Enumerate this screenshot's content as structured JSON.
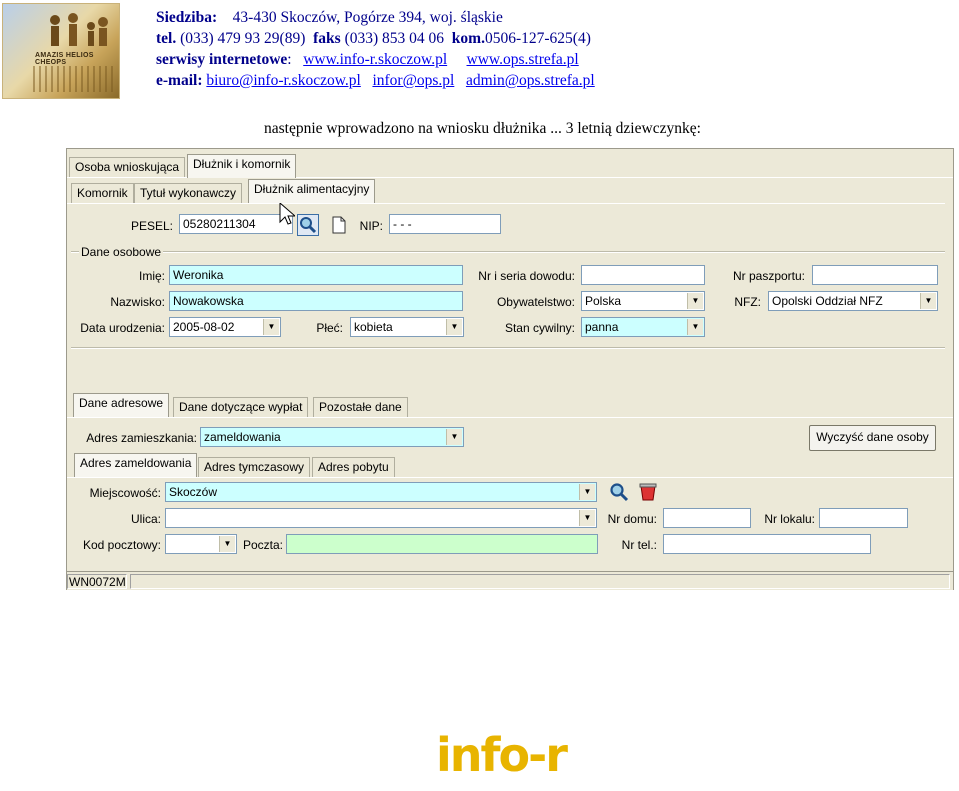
{
  "header": {
    "logo_text": "AMAZIS HELIOS CHEOPS",
    "siedziba_label": "Siedziba:",
    "siedziba_value": "43-430 Skoczów,  Pogórze 394,  woj. śląskie",
    "tel_label": "tel.",
    "tel_value": "(033) 479 93 29(89)",
    "faks_label": "faks",
    "faks_value": "(033) 853 04 06",
    "kom_label": "kom.",
    "kom_value": "0506-127-625(4)",
    "serwisy_label": "serwisy internetowe",
    "serwisy_colon": ":",
    "www1": "www.info-r.skoczow.pl",
    "www2": "www.ops.strefa.pl",
    "email_label": "e-mail:",
    "email1": "biuro@info-r.skoczow.pl",
    "email2": "infor@ops.pl",
    "email3": "admin@ops.strefa.pl"
  },
  "intro_text": "następnie wprowadzono na wniosku dłużnika ... 3 letnią dziewczynkę:",
  "window": {
    "top_tabs": [
      "Osoba wnioskująca",
      "Dłużnik i komornik"
    ],
    "sub_tabs": [
      "Komornik",
      "Tytuł wykonawczy",
      "Dłużnik alimentacyjny"
    ],
    "pesel_label": "PESEL:",
    "pesel_value": "05280211304",
    "nip_label": "NIP:",
    "nip_value": "- - -",
    "group_title": "Dane osobowe",
    "imie_label": "Imię:",
    "imie_value": "Weronika",
    "nazwisko_label": "Nazwisko:",
    "nazwisko_value": "Nowakowska",
    "data_ur_label": "Data urodzenia:",
    "data_ur_value": "2005-08-02",
    "plec_label": "Płeć:",
    "plec_value": "kobieta",
    "dowod_label": "Nr i seria dowodu:",
    "dowod_value": "",
    "obyw_label": "Obywatelstwo:",
    "obyw_value": "Polska",
    "stan_label": "Stan cywilny:",
    "stan_value": "panna",
    "paszport_label": "Nr paszportu:",
    "paszport_value": "",
    "nfz_label": "NFZ:",
    "nfz_value": "Opolski Oddział NFZ",
    "addr_tabs": [
      "Dane adresowe",
      "Dane dotyczące wypłat",
      "Pozostałe dane"
    ],
    "adres_zam_label": "Adres zamieszkania:",
    "adres_zam_value": "zameldowania",
    "clear_button": "Wyczyść dane osoby",
    "addr_sub_tabs": [
      "Adres zameldowania",
      "Adres tymczasowy",
      "Adres pobytu"
    ],
    "miejscowosc_label": "Miejscowość:",
    "miejscowosc_value": "Skoczów",
    "ulica_label": "Ulica:",
    "ulica_value": "",
    "kod_label": "Kod pocztowy:",
    "kod_value": "",
    "poczta_label": "Poczta:",
    "poczta_value": "",
    "nr_domu_label": "Nr domu:",
    "nr_domu_value": "",
    "nr_lokalu_label": "Nr lokalu:",
    "nr_lokalu_value": "",
    "nr_tel_label": "Nr tel.:",
    "nr_tel_value": "",
    "status_code": "WN0072M"
  },
  "footer": {
    "logo_text": "info-r"
  },
  "colors": {
    "header_text": "#00008b",
    "link": "#0000ee",
    "cyan_field": "#ccffff",
    "green_field": "#ccffcc",
    "window_bg": "#ece9d8",
    "footer_logo": "#e8b400"
  },
  "icons": [
    "search-icon",
    "new-document-icon",
    "dropdown-arrow-icon",
    "delete-icon",
    "mouse-cursor-icon"
  ]
}
